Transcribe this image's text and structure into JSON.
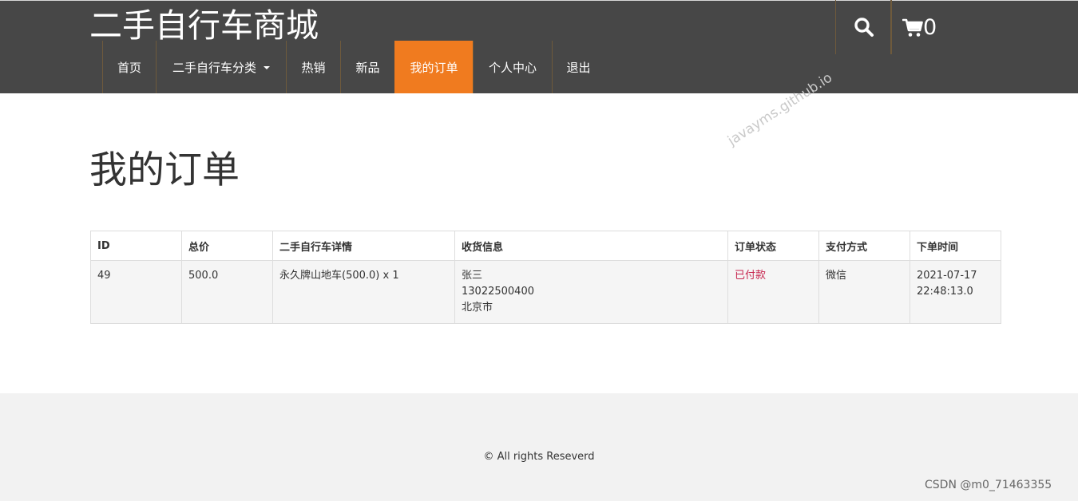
{
  "site": {
    "title": "二手自行车商城"
  },
  "header": {
    "search_icon": "search-icon",
    "cart_icon": "shopping-cart-icon",
    "cart_count": "0"
  },
  "nav": {
    "items": [
      {
        "label": "首页",
        "active": false
      },
      {
        "label": "二手自行车分类",
        "active": false,
        "has_dropdown": true
      },
      {
        "label": "热销",
        "active": false
      },
      {
        "label": "新品",
        "active": false
      },
      {
        "label": "我的订单",
        "active": true
      },
      {
        "label": "个人中心",
        "active": false
      },
      {
        "label": "退出",
        "active": false
      }
    ]
  },
  "main": {
    "title": "我的订单",
    "watermark": "javayms.github.io"
  },
  "orders_table": {
    "headers": [
      "ID",
      "总价",
      "二手自行车详情",
      "收货信息",
      "订单状态",
      "支付方式",
      "下单时间"
    ],
    "rows": [
      {
        "id": "49",
        "total": "500.0",
        "detail": "永久牌山地车(500.0) x 1",
        "receiver_name": "张三",
        "receiver_phone": "13022500400",
        "receiver_address": "北京市",
        "status": "已付款",
        "payment": "微信",
        "date": "2021-07-17",
        "time": "22:48:13.0"
      }
    ]
  },
  "footer": {
    "copyright": "© All rights Reseverd",
    "source_mark": "CSDN @m0_71463355"
  },
  "colors": {
    "header_bg": "#474747",
    "active_nav_bg": "#f07b1f",
    "status_paid": "#c7254e",
    "footer_bg": "#f2f2f2"
  }
}
